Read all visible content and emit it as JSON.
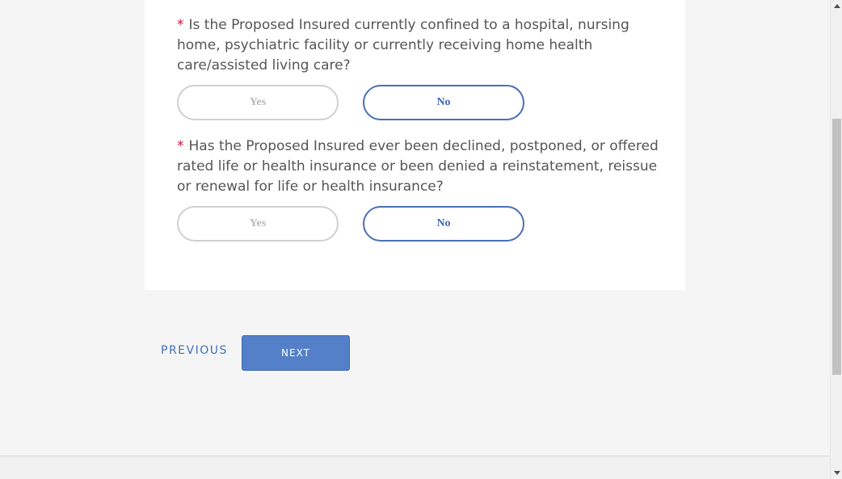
{
  "questions": [
    {
      "required_mark": "*",
      "text": "Is the Proposed Insured currently confined to a hospital, nursing home, psychiatric facility or currently receiving home health care/assisted living care?",
      "options": {
        "yes": "Yes",
        "no": "No"
      },
      "selected": "No"
    },
    {
      "required_mark": "*",
      "text": "Has the Proposed Insured ever been declined, postponed, or offered rated life or health insurance or been denied a reinstatement, reissue or renewal for life or health insurance?",
      "options": {
        "yes": "Yes",
        "no": "No"
      },
      "selected": "No"
    }
  ],
  "nav": {
    "previous_label": "PREVIOUS",
    "next_label": "NEXT"
  },
  "colors": {
    "accent": "#3f67b6",
    "next_button": "#5380c8",
    "required": "#d0103a"
  }
}
